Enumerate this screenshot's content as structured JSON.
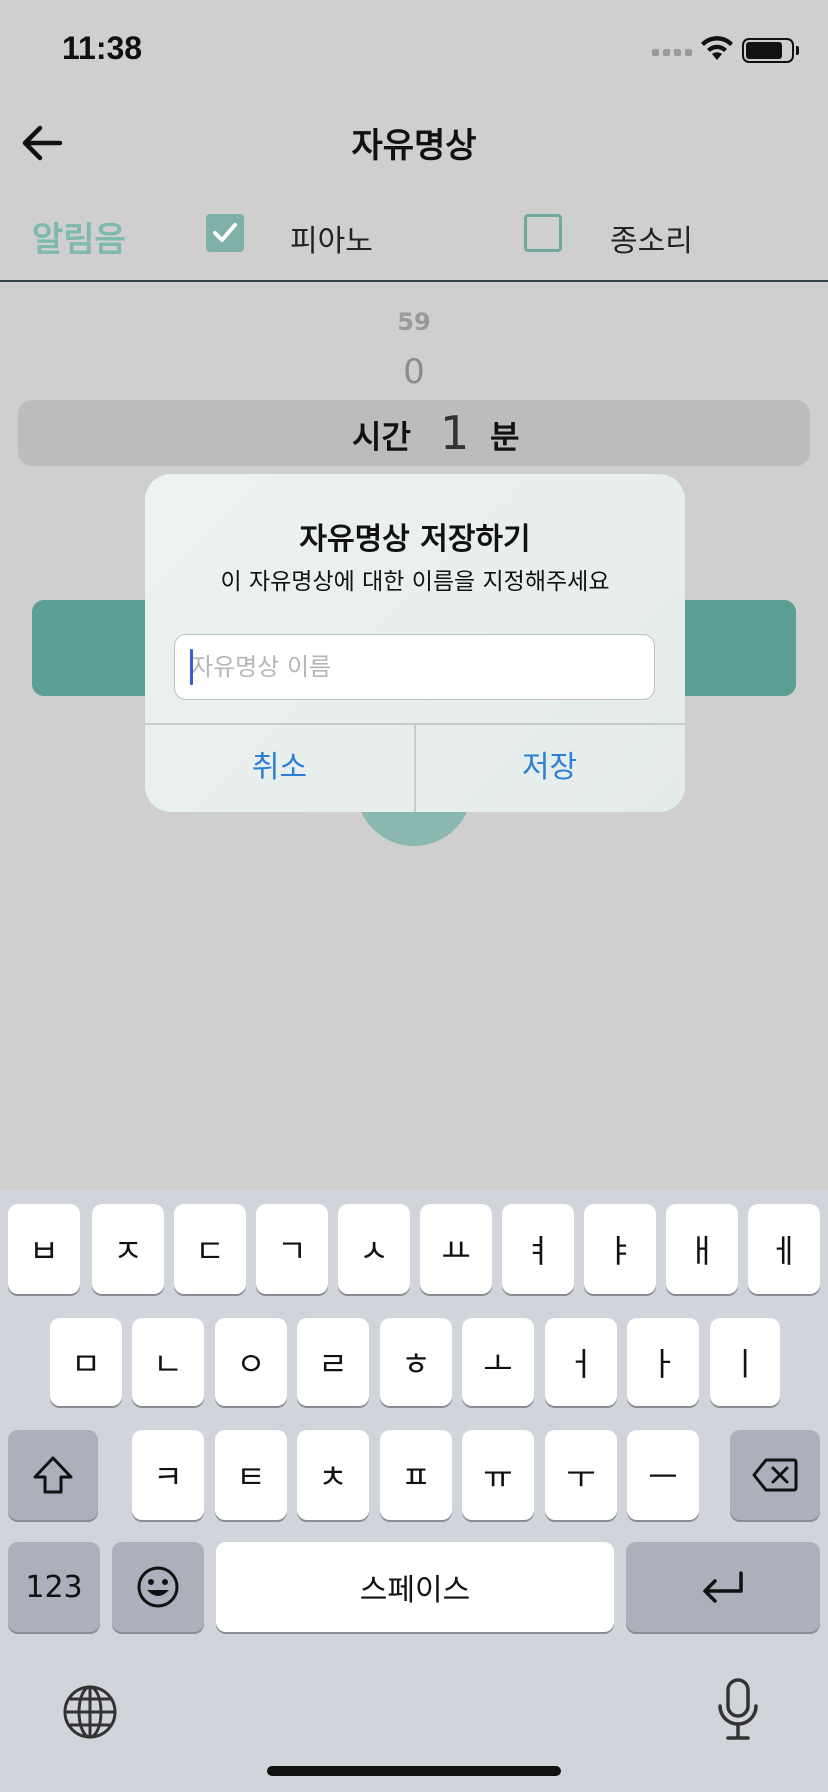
{
  "status_bar": {
    "time": "11:38"
  },
  "header": {
    "title": "자유명상"
  },
  "alarm": {
    "label": "알림음",
    "options": [
      {
        "label": "피아노",
        "checked": true
      },
      {
        "label": "종소리",
        "checked": false
      }
    ]
  },
  "picker": {
    "above_2": "59",
    "above_1": "0",
    "hour_label": "시간",
    "value": "1",
    "minute_label": "분"
  },
  "alert": {
    "title": "자유명상 저장하기",
    "message": "이 자유명상에 대한 이름을 지정해주세요",
    "input_placeholder": "자유명상 이름",
    "input_value": "",
    "cancel_label": "취소",
    "save_label": "저장"
  },
  "keyboard": {
    "row1": [
      "ㅂ",
      "ㅈ",
      "ㄷ",
      "ㄱ",
      "ㅅ",
      "ㅛ",
      "ㅕ",
      "ㅑ",
      "ㅐ",
      "ㅔ"
    ],
    "row2": [
      "ㅁ",
      "ㄴ",
      "ㅇ",
      "ㄹ",
      "ㅎ",
      "ㅗ",
      "ㅓ",
      "ㅏ",
      "ㅣ"
    ],
    "row3": [
      "ㅋ",
      "ㅌ",
      "ㅊ",
      "ㅍ",
      "ㅠ",
      "ㅜ",
      "ㅡ"
    ],
    "numbers_label": "123",
    "space_label": "스페이스",
    "icons": {
      "shift": "shift-icon",
      "delete": "delete-icon",
      "emoji": "emoji-icon",
      "return": "return-icon",
      "globe": "globe-icon",
      "mic": "microphone-icon"
    }
  },
  "colors": {
    "accent": "#5a9e94",
    "checkbox": "#7fb1a8",
    "alert_button": "#2a7fd6"
  }
}
